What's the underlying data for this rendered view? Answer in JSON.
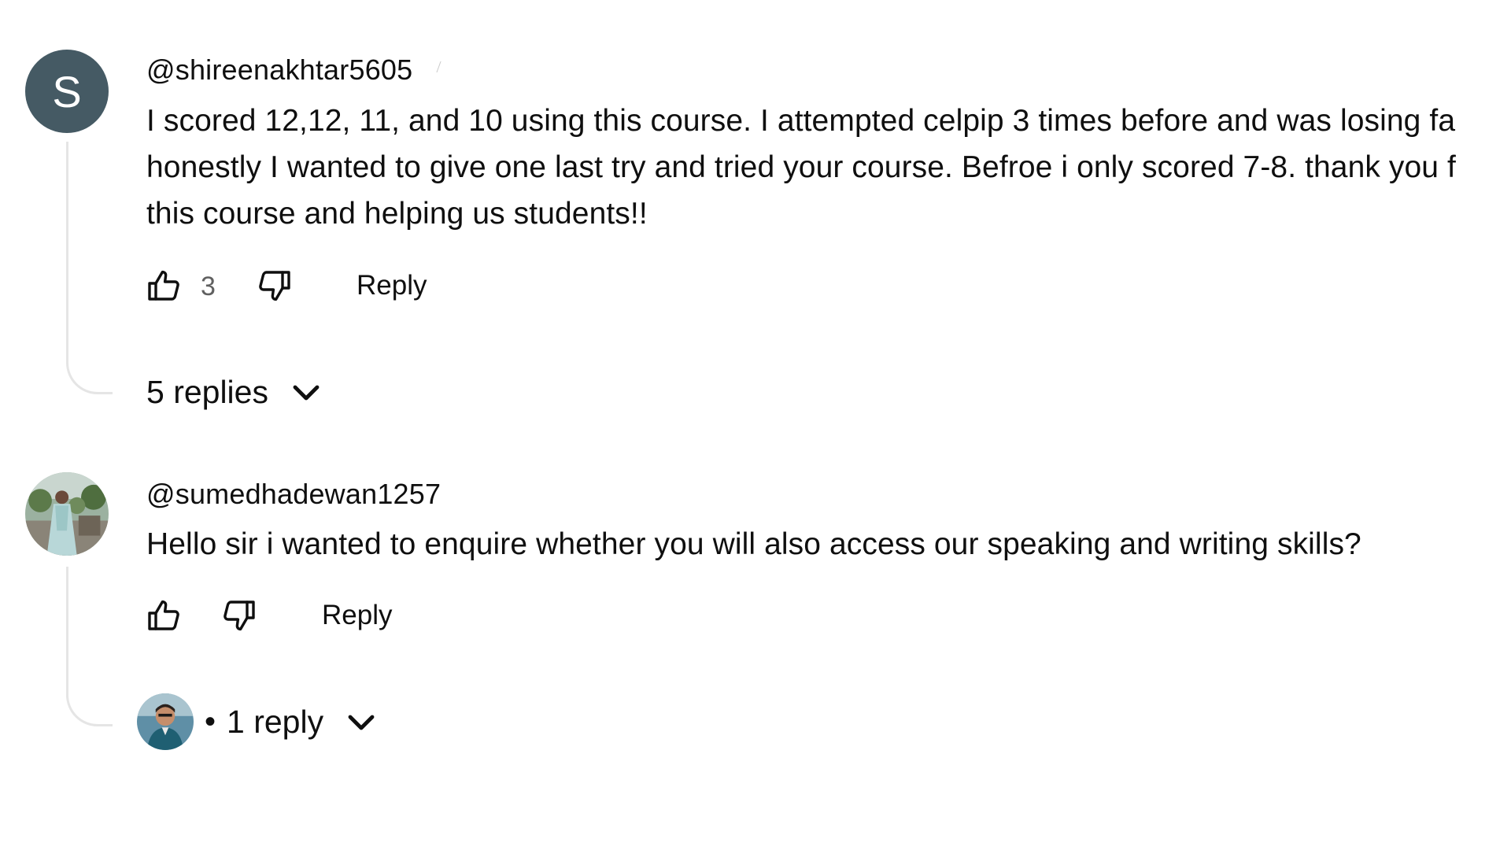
{
  "comments": [
    {
      "author": "@shireenakhtar5605",
      "avatar_letter": "S",
      "avatar_color": "#455a64",
      "text_lines": [
        "I scored 12,12, 11, and 10 using this course. I attempted celpip 3 times before and was losing fa",
        "honestly I wanted to give one last try and tried your course. Befroe i only scored 7-8. thank you f",
        "this course and helping us students!!"
      ],
      "like_count": "3",
      "like_icon": "thumbs-up-icon",
      "dislike_icon": "thumbs-down-icon",
      "reply_label": "Reply",
      "replies_label": "5 replies",
      "replies_icon": "chevron-down-icon"
    },
    {
      "author": "@sumedhadewan1257",
      "avatar_kind": "profile-photo",
      "text_lines": [
        "Hello sir i wanted to enquire whether you will also access our speaking and writing skills?"
      ],
      "like_icon": "thumbs-up-icon",
      "dislike_icon": "thumbs-down-icon",
      "reply_label": "Reply",
      "replies_separator": "•",
      "replies_label": "1 reply",
      "replies_icon": "chevron-down-icon"
    }
  ],
  "colors": {
    "text_primary": "#0f0f0f",
    "text_secondary": "#606060",
    "thread_line": "#e5e5e5",
    "background": "#ffffff"
  }
}
